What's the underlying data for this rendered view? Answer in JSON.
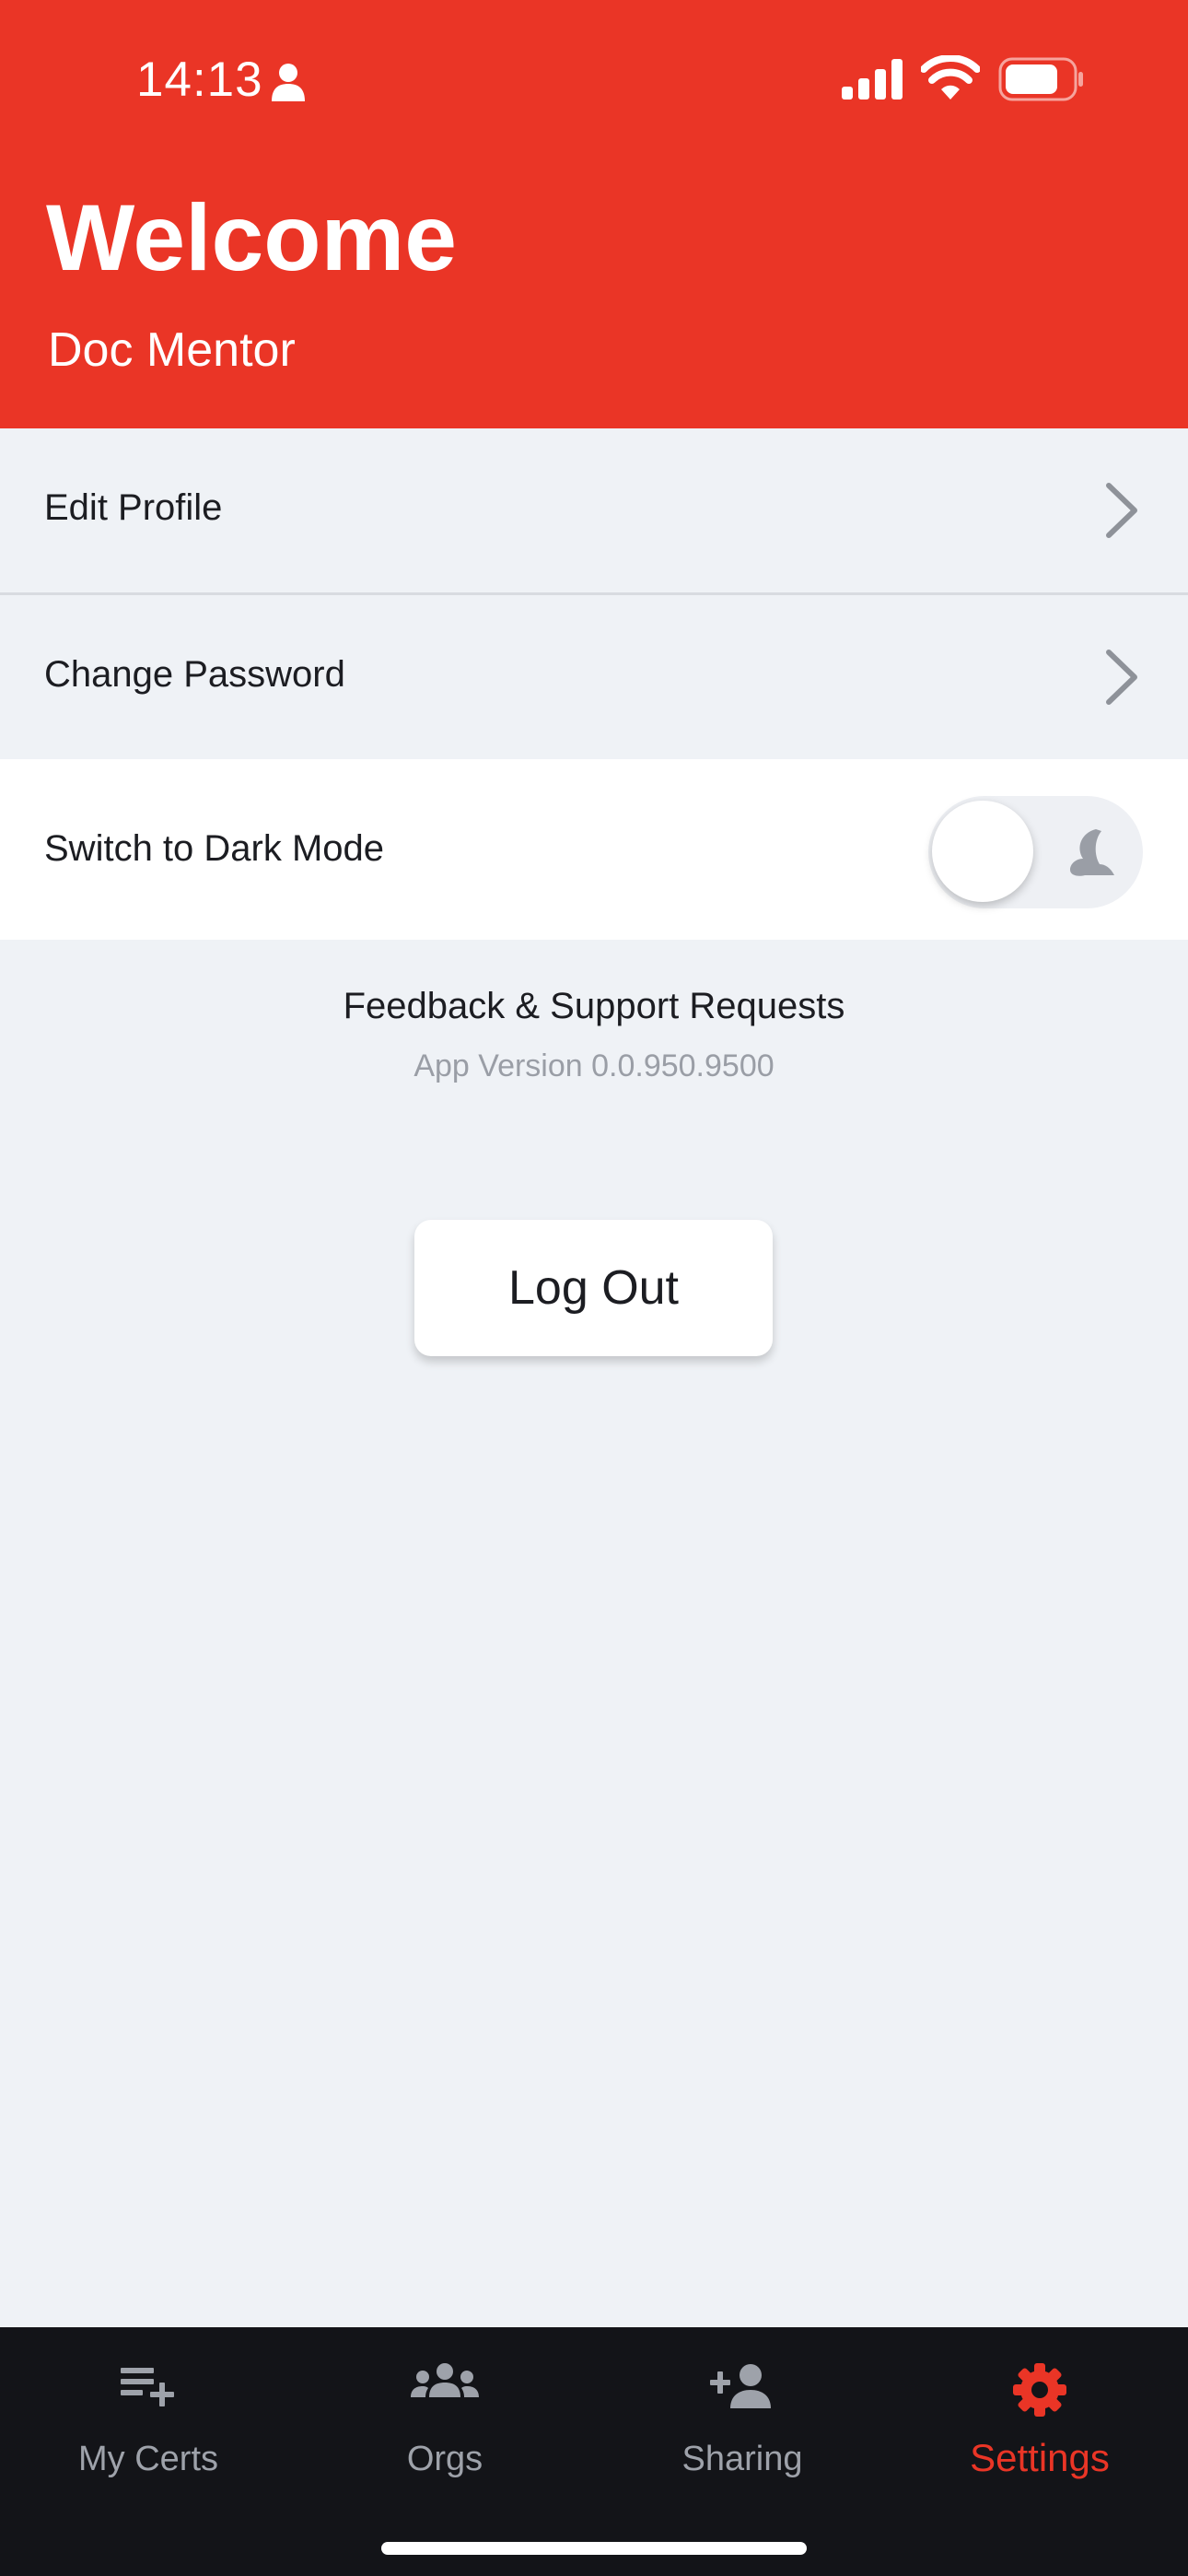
{
  "status_bar": {
    "time": "14:13"
  },
  "header": {
    "title": "Welcome",
    "username": "Doc Mentor"
  },
  "menu": {
    "edit_profile": "Edit Profile",
    "change_password": "Change Password",
    "dark_mode": "Switch to Dark Mode",
    "dark_mode_enabled": false
  },
  "info": {
    "feedback": "Feedback & Support Requests",
    "version": "App Version 0.0.950.9500"
  },
  "logout_label": "Log Out",
  "tabs": [
    {
      "label": "My Certs",
      "icon": "playlist-add-icon",
      "active": false
    },
    {
      "label": "Orgs",
      "icon": "group-icon",
      "active": false
    },
    {
      "label": "Sharing",
      "icon": "person-add-icon",
      "active": false
    },
    {
      "label": "Settings",
      "icon": "gear-icon",
      "active": true
    }
  ],
  "colors": {
    "brand_red": "#ea3526",
    "background": "#eff2f6",
    "tabbar": "#131418",
    "tab_inactive": "#9ea2aa"
  }
}
